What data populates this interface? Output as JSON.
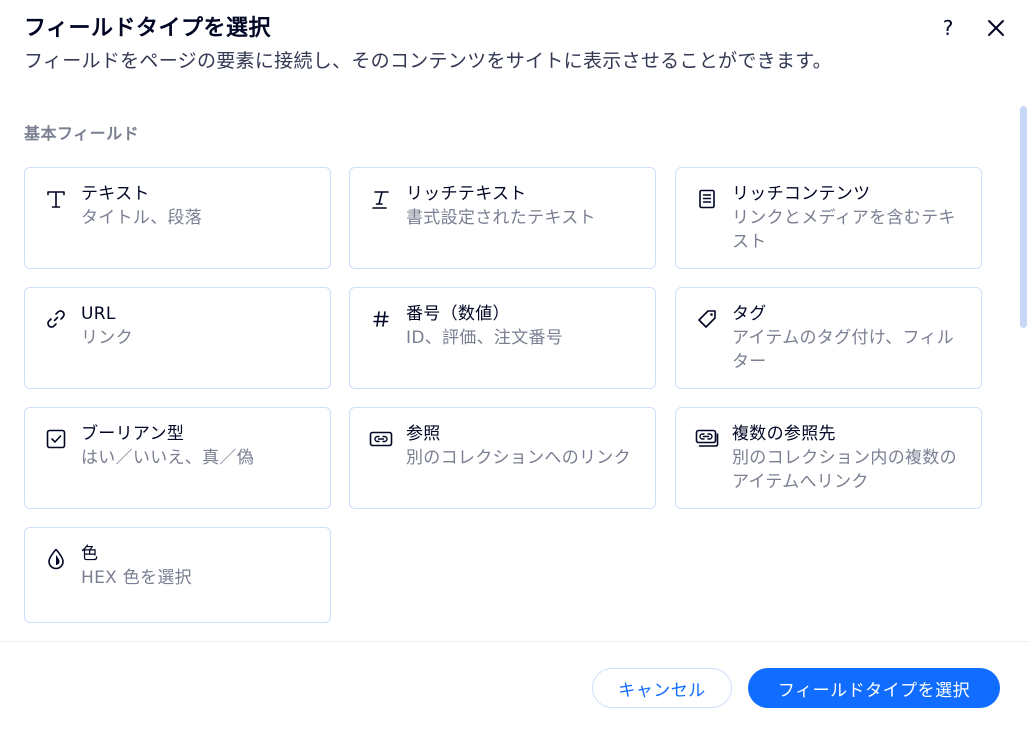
{
  "dialog": {
    "title": "フィールドタイプを選択",
    "subtitle": "フィールドをページの要素に接続し、そのコンテンツをサイトに表示させることができます。",
    "help_label": "?"
  },
  "section": {
    "label": "基本フィールド"
  },
  "fields": [
    {
      "label": "テキスト",
      "description": "タイトル、段落",
      "icon": "text-icon"
    },
    {
      "label": "リッチテキスト",
      "description": "書式設定されたテキスト",
      "icon": "rich-text-icon"
    },
    {
      "label": "リッチコンテンツ",
      "description": "リンクとメディアを含むテキスト",
      "icon": "document-icon"
    },
    {
      "label": "URL",
      "description": "リンク",
      "icon": "link-icon"
    },
    {
      "label": "番号（数値）",
      "description": "ID、評価、注文番号",
      "icon": "hash-icon"
    },
    {
      "label": "タグ",
      "description": "アイテムのタグ付け、フィルター",
      "icon": "tag-icon"
    },
    {
      "label": "ブーリアン型",
      "description": "はい／いいえ、真／偽",
      "icon": "checkbox-icon"
    },
    {
      "label": "参照",
      "description": "別のコレクションへのリンク",
      "icon": "reference-icon"
    },
    {
      "label": "複数の参照先",
      "description": "別のコレクション内の複数のアイテムへリンク",
      "icon": "multi-reference-icon"
    },
    {
      "label": "色",
      "description": "HEX 色を選択",
      "icon": "color-drop-icon"
    }
  ],
  "footer": {
    "cancel_label": "キャンセル",
    "confirm_label": "フィールドタイプを選択"
  },
  "colors": {
    "accent": "#116dff",
    "card_border": "#cfe0fb",
    "muted_text": "#7a7f92",
    "scrollbar": "#c8d6f7"
  }
}
